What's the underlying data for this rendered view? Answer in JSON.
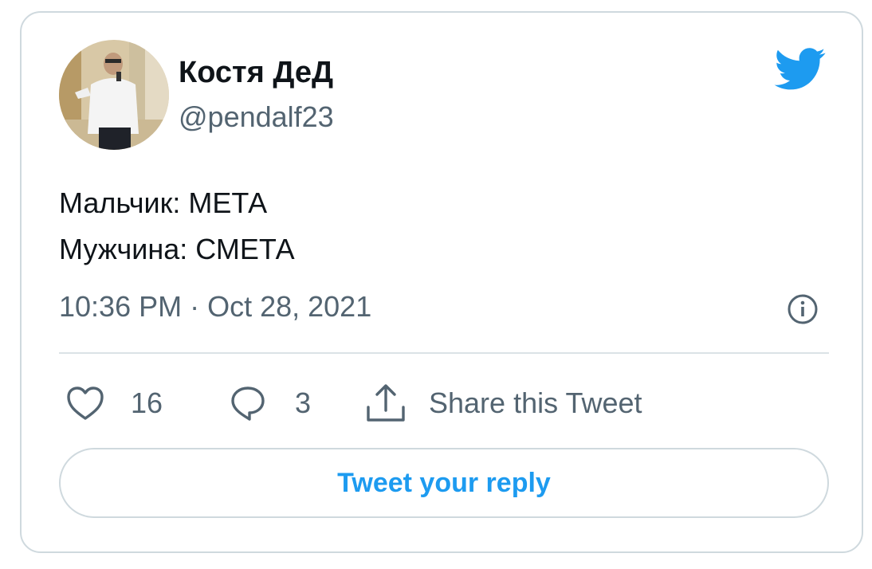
{
  "author": {
    "name": "Костя ДеД",
    "handle": "@pendalf23"
  },
  "tweet": {
    "lines": [
      "Мальчик: МЕТА",
      "Мужчина: СМЕТА"
    ],
    "timestamp": "10:36 PM · Oct 28, 2021"
  },
  "actions": {
    "likes": "16",
    "replies": "3",
    "share_label": "Share this Tweet"
  },
  "reply_button_label": "Tweet your reply",
  "icons": {
    "brand": "twitter-bird-icon",
    "info": "info-icon",
    "like": "heart-icon",
    "reply": "speech-bubble-icon",
    "share": "share-icon"
  },
  "colors": {
    "accent": "#1d9bf0",
    "secondary_text": "#536471",
    "border": "#cfd9de"
  }
}
